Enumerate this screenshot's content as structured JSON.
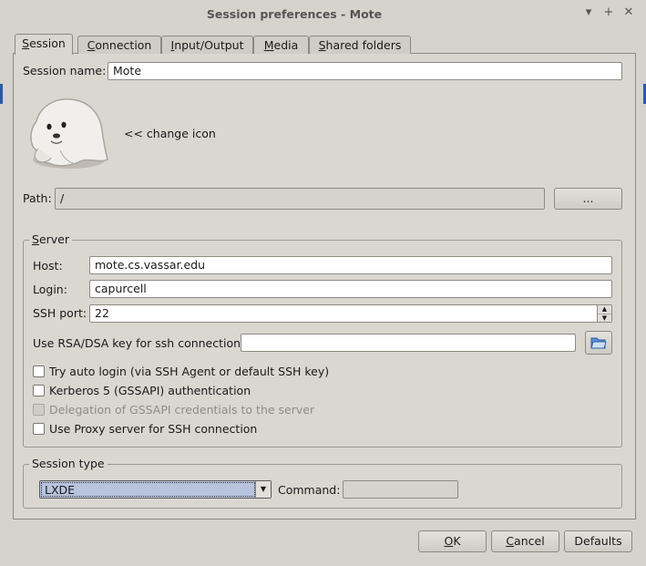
{
  "window": {
    "title": "Session preferences - Mote"
  },
  "window_controls": {
    "minimize": "▾",
    "maximize": "+",
    "close": "✕"
  },
  "tabs": [
    {
      "label": "Session",
      "mnemonic": "S",
      "rest": "ession"
    },
    {
      "label": "Connection",
      "mnemonic": "C",
      "rest": "onnection"
    },
    {
      "label": "Input/Output",
      "mnemonic": "I",
      "rest": "nput/Output"
    },
    {
      "label": "Media",
      "mnemonic": "M",
      "rest": "edia"
    },
    {
      "label": "Shared folders",
      "mnemonic": "S",
      "rest": "hared folders"
    }
  ],
  "session": {
    "name_label": "Session name:",
    "name_value": "Mote",
    "change_icon_label": "<< change icon",
    "path_label": "Path:",
    "path_value": "/",
    "path_button": "..."
  },
  "server": {
    "group_title_mnemonic": "S",
    "group_title_rest": "erver",
    "host_label": "Host:",
    "host_value": "mote.cs.vassar.edu",
    "login_label": "Login:",
    "login_value": "capurcell",
    "port_label": "SSH port:",
    "port_value": "22",
    "rsa_label": "Use RSA/DSA key for ssh connection:",
    "rsa_value": "",
    "options": [
      {
        "label": "Try auto login (via SSH Agent or default SSH key)",
        "checked": false,
        "disabled": false
      },
      {
        "label": "Kerberos 5 (GSSAPI) authentication",
        "checked": false,
        "disabled": false
      },
      {
        "label": "Delegation of GSSAPI credentials to the server",
        "checked": false,
        "disabled": true
      },
      {
        "label": "Use Proxy server for SSH connection",
        "checked": false,
        "disabled": false
      }
    ]
  },
  "session_type": {
    "group_title": "Session type",
    "selected": "LXDE",
    "command_label": "Command:",
    "command_value": ""
  },
  "buttons": {
    "ok_mnemonic": "O",
    "ok_rest": "K",
    "cancel_mnemonic": "C",
    "cancel_rest": "ancel",
    "defaults": "Defaults"
  },
  "colors": {
    "background": "#d6d2cc",
    "accent": "#2a5aa8",
    "select_bg": "#b8c4de"
  }
}
